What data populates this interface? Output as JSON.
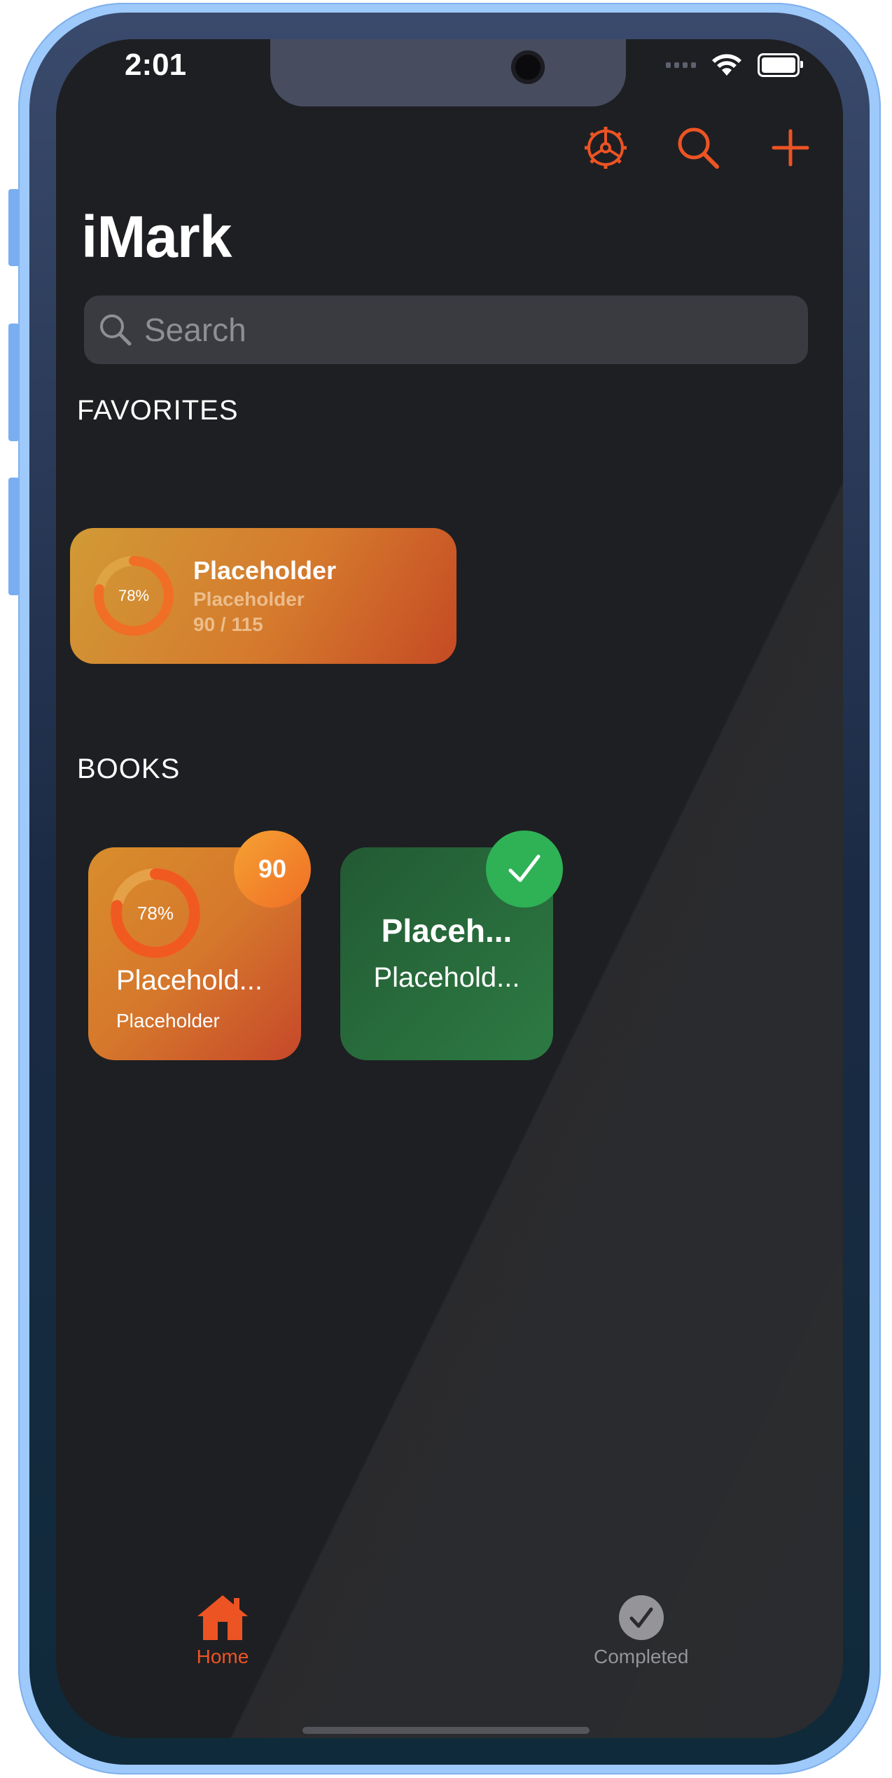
{
  "status_bar": {
    "time": "2:01"
  },
  "app": {
    "title": "iMark",
    "accent": "#ec5424"
  },
  "nav": {
    "icons": [
      "gear-icon",
      "search-icon",
      "plus-icon"
    ]
  },
  "search": {
    "placeholder": "Search"
  },
  "favorites": {
    "header": "FAVORITES",
    "items": [
      {
        "title": "Placeholder",
        "subtitle": "Placeholder",
        "progress": "90 / 115",
        "percent_label": "78%",
        "percent": 78
      }
    ]
  },
  "books": {
    "header": "BOOKS",
    "items": [
      {
        "title": "Placehold...",
        "subtitle": "Placeholder",
        "percent_label": "78%",
        "percent": 78,
        "badge": "90",
        "color": "#d6782c"
      },
      {
        "title": "Placeh...",
        "subtitle": "Placehold...",
        "badge": "check-icon",
        "color": "#2d7a43"
      }
    ]
  },
  "tabs": [
    {
      "label": "Home",
      "icon": "home-icon",
      "active": true
    },
    {
      "label": "Completed",
      "icon": "check-circle-icon",
      "active": false
    }
  ]
}
